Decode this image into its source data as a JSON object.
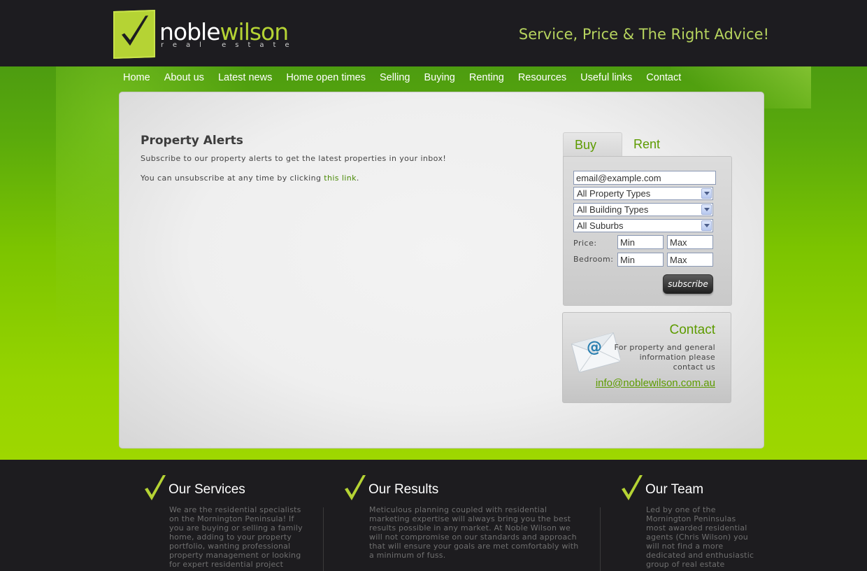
{
  "brand": {
    "name_part1": "noble",
    "name_part2": "wilson",
    "sub": "real estate",
    "tagline": "Service, Price & The Right Advice!",
    "accent": "#b5d334",
    "green": "#5d9b00"
  },
  "nav": [
    "Home",
    "About us",
    "Latest news",
    "Home open times",
    "Selling",
    "Buying",
    "Renting",
    "Resources",
    "Useful links",
    "Contact"
  ],
  "main": {
    "title": "Property Alerts",
    "para1": "Subscribe to our property alerts to get the latest properties in your inbox!",
    "para2_before": "You can unsubscribe at any time by clicking ",
    "para2_link": "this link",
    "para2_after": "."
  },
  "alerts": {
    "tabs": [
      "Buy",
      "Rent"
    ],
    "email_value": "email@example.com",
    "property_type": "All Property Types",
    "building_type": "All Building Types",
    "suburb": "All Suburbs",
    "price_label": "Price:",
    "bedroom_label": "Bedroom:",
    "min": "Min",
    "max": "Max",
    "subscribe_label": "subscribe"
  },
  "contact": {
    "title": "Contact",
    "text": "For property and general information please contact us",
    "email": "info@noblewilson.com.au"
  },
  "footer": {
    "services_title": "Our Services",
    "services_text": "We are the residential specialists on the Mornington Peninsula! If you are buying or selling a family home, adding to your property portfolio, wanting professional property management or looking for expert residential project",
    "results_title": "Our Results",
    "results_text": "Meticulous planning coupled with residential marketing expertise will always bring you the best results possible in any market. At Noble Wilson we will not compromise on our standards and approach that will ensure your goals are met comfortably with a minimum of fuss.",
    "team_title": "Our Team",
    "team_text": "Led by one of the Mornington Peninsulas most awarded residential agents (Chris Wilson) you will not find a more dedicated and enthusiastic group of real estate"
  }
}
